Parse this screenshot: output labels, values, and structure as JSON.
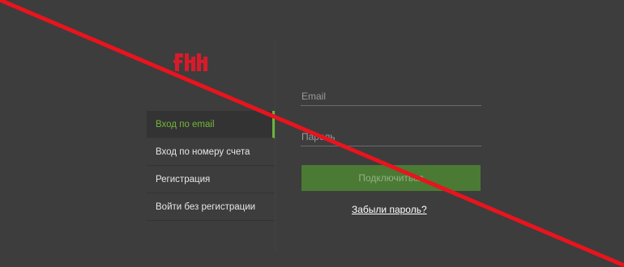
{
  "brand": {
    "logo_text": "",
    "logo_color": "#d91a2a"
  },
  "menu": {
    "items": [
      {
        "label": "Вход по email",
        "active": true
      },
      {
        "label": "Вход по номеру счета",
        "active": false
      },
      {
        "label": "Регистрация",
        "active": false
      },
      {
        "label": "Войти без регистрации",
        "active": false
      }
    ]
  },
  "form": {
    "email_placeholder": "Email",
    "email_value": "",
    "password_placeholder": "Пароль",
    "password_value": "",
    "submit_label": "Подключиться",
    "forgot_link": "Забыли пароль?"
  },
  "colors": {
    "background": "#3d3d3d",
    "accent": "#6db33f",
    "button": "#4a7a34",
    "overlay_line": "#e8141e"
  }
}
